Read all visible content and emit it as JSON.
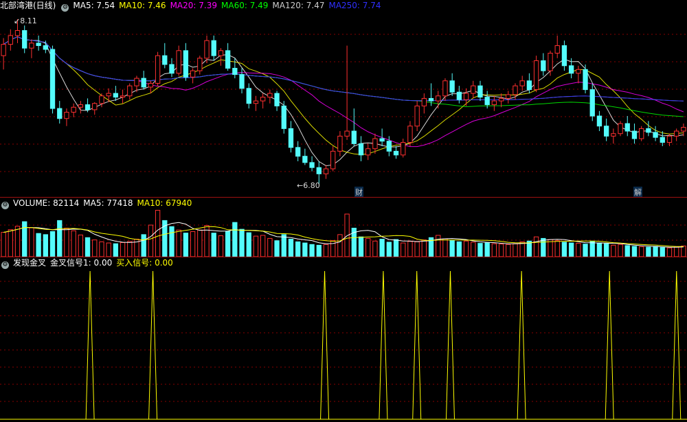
{
  "main": {
    "title": "北部湾港(日线)",
    "ma5": {
      "label": "MA5: 7.54",
      "color": "#ffffff"
    },
    "ma10": {
      "label": "MA10: 7.46",
      "color": "#ffff00"
    },
    "ma20": {
      "label": "MA20: 7.39",
      "color": "#ff00ff"
    },
    "ma60": {
      "label": "MA60: 7.49",
      "color": "#00ff00"
    },
    "ma120": {
      "label": "MA120: 7.47",
      "color": "#cccccc"
    },
    "ma250": {
      "label": "MA250: 7.74",
      "color": "#2020ff"
    },
    "high_marker": "8.11",
    "low_marker": "6.80",
    "event_cai": "财",
    "event_jie": "解"
  },
  "volume": {
    "vol": {
      "label": "VOLUME: 82114",
      "color": "#ffffff"
    },
    "ma5": {
      "label": "MA5: 77418",
      "color": "#ffffff"
    },
    "ma10": {
      "label": "MA10: 67940",
      "color": "#ffff00"
    }
  },
  "indicator": {
    "name": "发现金叉",
    "signal1": {
      "label": "金叉信号1: 0.00",
      "color": "#ffffff"
    },
    "signal2": {
      "label": "买入信号: 0.00",
      "color": "#ffff00"
    }
  },
  "colors": {
    "up": "#ff3030",
    "down": "#54fcfc",
    "grid": "#8a0000",
    "spike": "#ffff00"
  },
  "chart_data": {
    "type": "candlestick",
    "y_range": [
      6.8,
      8.11
    ],
    "candles": [
      [
        7.82,
        7.96,
        7.71,
        7.91
      ],
      [
        7.91,
        8.03,
        7.86,
        7.98
      ],
      [
        7.98,
        8.11,
        7.92,
        8.02
      ],
      [
        8.02,
        8.06,
        7.84,
        7.88
      ],
      [
        7.88,
        7.95,
        7.8,
        7.92
      ],
      [
        7.92,
        7.98,
        7.86,
        7.9
      ],
      [
        7.9,
        7.94,
        7.84,
        7.87
      ],
      [
        7.87,
        7.9,
        7.36,
        7.4
      ],
      [
        7.4,
        7.46,
        7.28,
        7.32
      ],
      [
        7.32,
        7.4,
        7.26,
        7.37
      ],
      [
        7.37,
        7.44,
        7.33,
        7.41
      ],
      [
        7.41,
        7.46,
        7.36,
        7.43
      ],
      [
        7.43,
        7.48,
        7.37,
        7.39
      ],
      [
        7.39,
        7.45,
        7.35,
        7.44
      ],
      [
        7.44,
        7.52,
        7.41,
        7.5
      ],
      [
        7.5,
        7.56,
        7.45,
        7.52
      ],
      [
        7.52,
        7.58,
        7.46,
        7.49
      ],
      [
        7.49,
        7.55,
        7.44,
        7.5
      ],
      [
        7.5,
        7.6,
        7.47,
        7.58
      ],
      [
        7.58,
        7.66,
        7.53,
        7.64
      ],
      [
        7.64,
        7.7,
        7.55,
        7.57
      ],
      [
        7.57,
        7.62,
        7.52,
        7.6
      ],
      [
        7.6,
        7.85,
        7.58,
        7.82
      ],
      [
        7.82,
        7.92,
        7.72,
        7.75
      ],
      [
        7.75,
        7.8,
        7.65,
        7.68
      ],
      [
        7.68,
        7.9,
        7.66,
        7.86
      ],
      [
        7.86,
        7.92,
        7.62,
        7.65
      ],
      [
        7.65,
        7.72,
        7.6,
        7.7
      ],
      [
        7.7,
        7.82,
        7.67,
        7.8
      ],
      [
        7.8,
        7.98,
        7.76,
        7.94
      ],
      [
        7.94,
        7.98,
        7.78,
        7.82
      ],
      [
        7.82,
        7.88,
        7.74,
        7.86
      ],
      [
        7.86,
        7.92,
        7.7,
        7.72
      ],
      [
        7.72,
        7.8,
        7.64,
        7.67
      ],
      [
        7.67,
        7.72,
        7.52,
        7.56
      ],
      [
        7.56,
        7.6,
        7.4,
        7.44
      ],
      [
        7.44,
        7.5,
        7.38,
        7.46
      ],
      [
        7.46,
        7.52,
        7.4,
        7.49
      ],
      [
        7.49,
        7.55,
        7.44,
        7.52
      ],
      [
        7.52,
        7.54,
        7.38,
        7.42
      ],
      [
        7.42,
        7.46,
        7.2,
        7.24
      ],
      [
        7.24,
        7.3,
        7.05,
        7.09
      ],
      [
        7.09,
        7.14,
        6.98,
        7.02
      ],
      [
        7.02,
        7.08,
        6.95,
        6.97
      ],
      [
        6.97,
        7.02,
        6.9,
        6.93
      ],
      [
        6.93,
        6.98,
        6.8,
        6.88
      ],
      [
        6.88,
        6.95,
        6.84,
        6.92
      ],
      [
        6.92,
        7.1,
        6.9,
        7.06
      ],
      [
        7.06,
        7.22,
        7.02,
        7.18
      ],
      [
        7.18,
        7.9,
        7.15,
        7.22
      ],
      [
        7.22,
        7.4,
        7.1,
        7.12
      ],
      [
        7.12,
        7.18,
        6.98,
        7.03
      ],
      [
        7.03,
        7.12,
        6.99,
        7.08
      ],
      [
        7.08,
        7.2,
        7.04,
        7.16
      ],
      [
        7.16,
        7.24,
        7.1,
        7.14
      ],
      [
        7.14,
        7.18,
        7.02,
        7.06
      ],
      [
        7.06,
        7.1,
        7.0,
        7.03
      ],
      [
        7.03,
        7.16,
        7.01,
        7.13
      ],
      [
        7.13,
        7.3,
        7.1,
        7.26
      ],
      [
        7.26,
        7.46,
        7.22,
        7.42
      ],
      [
        7.42,
        7.52,
        7.36,
        7.48
      ],
      [
        7.48,
        7.6,
        7.42,
        7.46
      ],
      [
        7.46,
        7.54,
        7.4,
        7.5
      ],
      [
        7.5,
        7.64,
        7.46,
        7.62
      ],
      [
        7.62,
        7.68,
        7.5,
        7.53
      ],
      [
        7.53,
        7.58,
        7.44,
        7.47
      ],
      [
        7.47,
        7.56,
        7.42,
        7.52
      ],
      [
        7.52,
        7.62,
        7.48,
        7.58
      ],
      [
        7.58,
        7.62,
        7.46,
        7.49
      ],
      [
        7.49,
        7.54,
        7.4,
        7.43
      ],
      [
        7.43,
        7.5,
        7.38,
        7.46
      ],
      [
        7.46,
        7.52,
        7.41,
        7.48
      ],
      [
        7.48,
        7.54,
        7.44,
        7.51
      ],
      [
        7.51,
        7.6,
        7.47,
        7.58
      ],
      [
        7.58,
        7.66,
        7.54,
        7.62
      ],
      [
        7.62,
        7.68,
        7.52,
        7.55
      ],
      [
        7.55,
        7.82,
        7.53,
        7.78
      ],
      [
        7.78,
        7.84,
        7.66,
        7.7
      ],
      [
        7.7,
        7.86,
        7.66,
        7.84
      ],
      [
        7.84,
        7.98,
        7.8,
        7.9
      ],
      [
        7.9,
        7.94,
        7.7,
        7.74
      ],
      [
        7.74,
        7.8,
        7.64,
        7.68
      ],
      [
        7.68,
        7.74,
        7.6,
        7.71
      ],
      [
        7.71,
        7.75,
        7.52,
        7.55
      ],
      [
        7.55,
        7.6,
        7.3,
        7.34
      ],
      [
        7.34,
        7.38,
        7.22,
        7.26
      ],
      [
        7.26,
        7.32,
        7.14,
        7.18
      ],
      [
        7.18,
        7.24,
        7.12,
        7.2
      ],
      [
        7.2,
        7.3,
        7.18,
        7.28
      ],
      [
        7.28,
        7.34,
        7.18,
        7.22
      ],
      [
        7.22,
        7.28,
        7.12,
        7.16
      ],
      [
        7.16,
        7.26,
        7.14,
        7.24
      ],
      [
        7.24,
        7.3,
        7.18,
        7.21
      ],
      [
        7.21,
        7.26,
        7.14,
        7.17
      ],
      [
        7.17,
        7.22,
        7.1,
        7.13
      ],
      [
        7.13,
        7.2,
        7.1,
        7.18
      ],
      [
        7.18,
        7.24,
        7.14,
        7.22
      ],
      [
        7.22,
        7.28,
        7.18,
        7.25
      ]
    ],
    "volume_y_range": [
      0,
      130000
    ],
    "volumes": [
      64000,
      71000,
      80000,
      92000,
      76000,
      61000,
      58000,
      66000,
      95000,
      75000,
      68000,
      57000,
      50000,
      44000,
      39000,
      36000,
      34000,
      37000,
      40000,
      46000,
      58000,
      83000,
      122000,
      95000,
      79000,
      70000,
      62000,
      66000,
      70000,
      82000,
      62000,
      55000,
      67000,
      90000,
      72000,
      63000,
      54000,
      56000,
      48000,
      42000,
      58000,
      46000,
      39000,
      36000,
      32000,
      30000,
      32000,
      42000,
      58000,
      112000,
      75000,
      52000,
      48000,
      41000,
      46000,
      38000,
      45000,
      36000,
      40000,
      39000,
      44000,
      50000,
      56000,
      47000,
      42000,
      39000,
      41000,
      38000,
      35000,
      36000,
      34000,
      33000,
      32000,
      34000,
      39000,
      41000,
      52000,
      48000,
      45000,
      42000,
      38000,
      36000,
      35000,
      33000,
      40000,
      36000,
      34000,
      30000,
      32000,
      29000,
      27000,
      26000,
      25000,
      27000,
      24000,
      23000,
      25000,
      28000
    ],
    "signal_spike_dates": [
      21,
      36,
      77,
      91,
      99,
      107,
      124,
      145,
      161
    ]
  }
}
